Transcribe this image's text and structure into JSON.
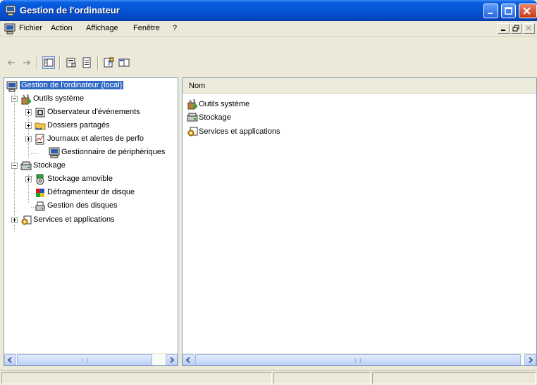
{
  "window": {
    "title": "Gestion de l'ordinateur"
  },
  "menubar": {
    "items": [
      "Fichier",
      "Action",
      "Affichage",
      "Fenêtre",
      "?"
    ]
  },
  "toolbar": {
    "buttons": [
      "back-arrow-icon",
      "forward-arrow-icon",
      "show-hide-tree-icon",
      "properties-icon",
      "export-list-icon",
      "help-icon",
      "console-view-icon"
    ]
  },
  "tree": {
    "root": "Gestion de l'ordinateur (local)",
    "items": [
      {
        "label": "Outils système",
        "level": 1,
        "expander": "minus"
      },
      {
        "label": "Observateur d'événements",
        "level": 2,
        "expander": "plus"
      },
      {
        "label": "Dossiers partagés",
        "level": 2,
        "expander": "plus"
      },
      {
        "label": "Journaux et alertes de perfo",
        "level": 2,
        "expander": "plus"
      },
      {
        "label": "Gestionnaire de périphériques",
        "level": 2,
        "expander": "none"
      },
      {
        "label": "Stockage",
        "level": 1,
        "expander": "minus"
      },
      {
        "label": "Stockage amovible",
        "level": 2,
        "expander": "plus"
      },
      {
        "label": "Défragmenteur de disque",
        "level": 2,
        "expander": "none"
      },
      {
        "label": "Gestion des disques",
        "level": 2,
        "expander": "none"
      },
      {
        "label": "Services et applications",
        "level": 1,
        "expander": "plus"
      }
    ]
  },
  "list": {
    "column_header": "Nom",
    "items": [
      "Outils système",
      "Stockage",
      "Services et applications"
    ]
  },
  "colors": {
    "titlebar": "#0553d6",
    "selection": "#316ac5",
    "window_bg": "#ece9d8"
  }
}
